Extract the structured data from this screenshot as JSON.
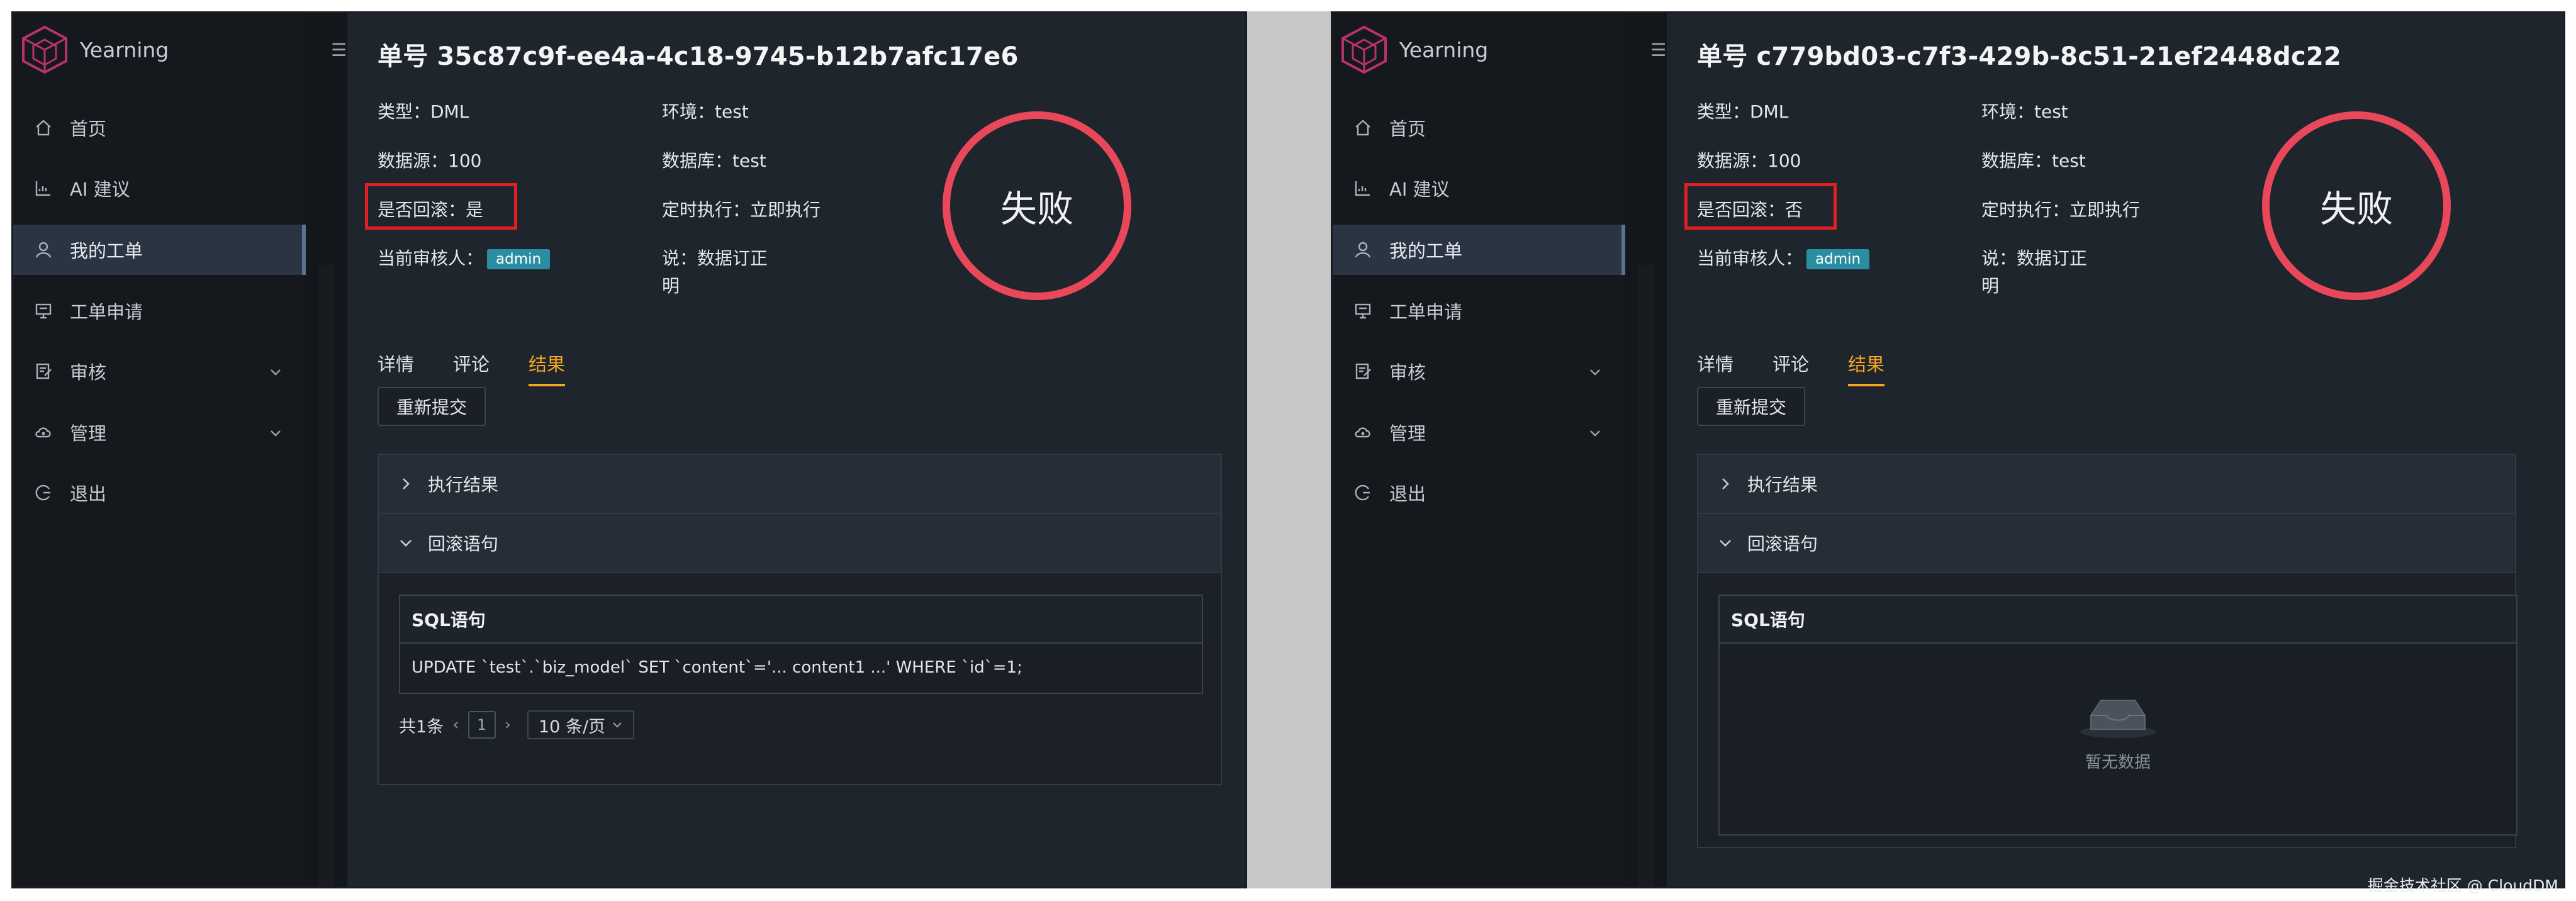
{
  "app": {
    "name": "Yearning"
  },
  "menu": [
    {
      "label": "首页",
      "icon": "home-icon"
    },
    {
      "label": "AI 建议",
      "icon": "chart-icon"
    },
    {
      "label": "我的工单",
      "icon": "user-icon"
    },
    {
      "label": "工单申请",
      "icon": "monitor-icon"
    },
    {
      "label": "审核",
      "icon": "audit-icon"
    },
    {
      "label": "管理",
      "icon": "cloud-icon"
    },
    {
      "label": "退出",
      "icon": "logout-icon"
    }
  ],
  "labels": {
    "type": "类型：DML",
    "env": "环境：test",
    "datasource": "数据源：100",
    "database": "数据库：test",
    "schedule": "定时执行：立即执行",
    "reviewer": "当前审核人：",
    "reviewer_badge": "admin",
    "desc_line1": "说：数据订正",
    "desc_line2": "明",
    "status": "失败",
    "tab_detail": "详情",
    "tab_comment": "评论",
    "tab_result": "结果",
    "resubmit": "重新提交",
    "exec_result": "执行结果",
    "rollback_stmt": "回滚语句",
    "sql_header": "SQL语句"
  },
  "left": {
    "order_title": "单号 35c87c9f-ee4a-4c18-9745-b12b7afc17e6",
    "rollback": "是否回滚：是",
    "sql_row": "UPDATE `test`.`biz_model` SET `content`='... content1 ...' WHERE `id`=1;",
    "pager_total": "共1条",
    "pager_page": "1",
    "pager_size": "10 条/页"
  },
  "right": {
    "order_title": "单号 c779bd03-c7f3-429b-8c51-21ef2448dc22",
    "rollback": "是否回滚：否",
    "empty_text": "暂无数据"
  },
  "watermark": "掘金技术社区 @ CloudDM",
  "colors": {
    "accent": "#f5a623",
    "fail_ring": "#e8485a",
    "highlight_box": "#e02020",
    "badge": "#2a8ea3"
  }
}
